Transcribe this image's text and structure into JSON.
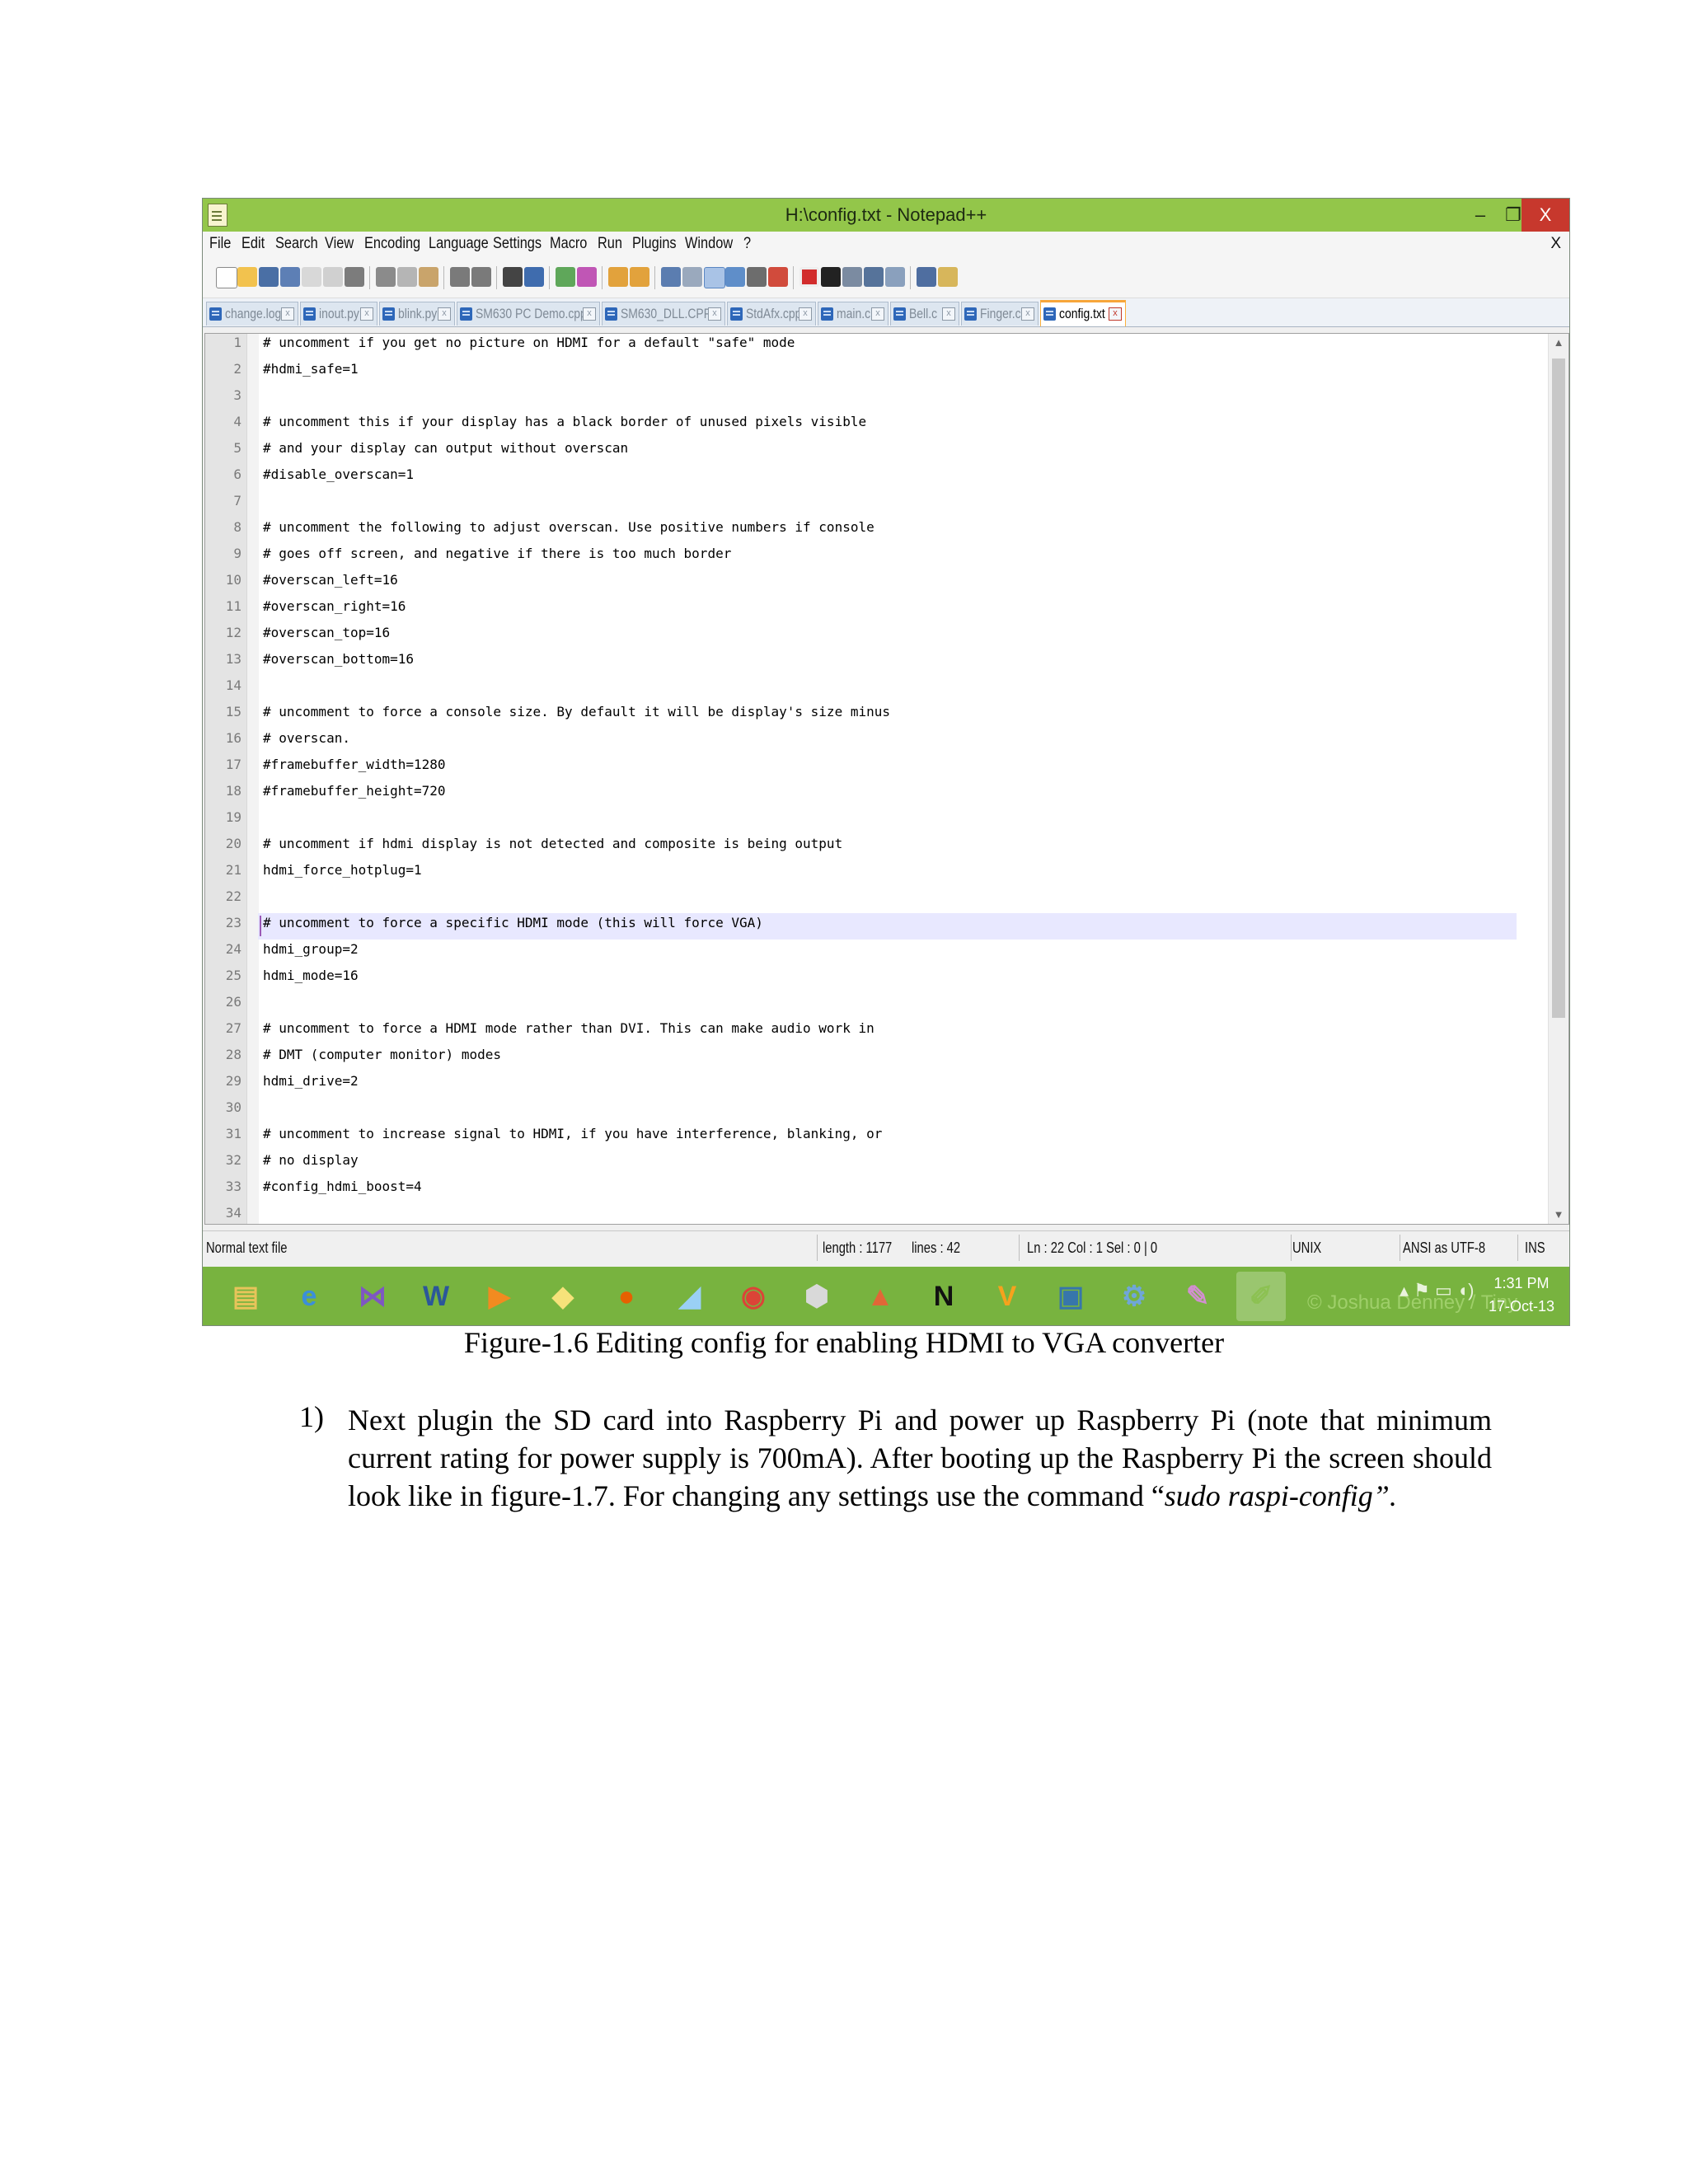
{
  "window": {
    "title": "H:\\config.txt - Notepad++",
    "min": "–",
    "restore": "❐",
    "close": "X"
  },
  "menu": {
    "items": [
      "File",
      "Edit",
      "Search",
      "View",
      "Encoding",
      "Language",
      "Settings",
      "Macro",
      "Run",
      "Plugins",
      "Window",
      "?"
    ],
    "close": "X"
  },
  "tabs": [
    {
      "label": "change.log",
      "active": false
    },
    {
      "label": "inout.py",
      "active": false
    },
    {
      "label": "blink.py",
      "active": false
    },
    {
      "label": "SM630 PC Demo.cpp",
      "active": false
    },
    {
      "label": "SM630_DLL.CPP",
      "active": false
    },
    {
      "label": "StdAfx.cpp",
      "active": false
    },
    {
      "label": "main.c",
      "active": false
    },
    {
      "label": "Bell.c",
      "active": false
    },
    {
      "label": "Finger.c",
      "active": false
    },
    {
      "label": "config.txt",
      "active": true
    }
  ],
  "editor": {
    "lines": [
      "# uncomment if you get no picture on HDMI for a default \"safe\" mode",
      "#hdmi_safe=1",
      "",
      "# uncomment this if your display has a black border of unused pixels visible",
      "# and your display can output without overscan",
      "#disable_overscan=1",
      "",
      "# uncomment the following to adjust overscan. Use positive numbers if console",
      "# goes off screen, and negative if there is too much border",
      "#overscan_left=16",
      "#overscan_right=16",
      "#overscan_top=16",
      "#overscan_bottom=16",
      "",
      "# uncomment to force a console size. By default it will be display's size minus",
      "# overscan.",
      "#framebuffer_width=1280",
      "#framebuffer_height=720",
      "",
      "# uncomment if hdmi display is not detected and composite is being output",
      "hdmi_force_hotplug=1",
      "",
      "# uncomment to force a specific HDMI mode (this will force VGA)",
      "hdmi_group=2",
      "hdmi_mode=16",
      "",
      "# uncomment to force a HDMI mode rather than DVI. This can make audio work in",
      "# DMT (computer monitor) modes",
      "hdmi_drive=2",
      "",
      "# uncomment to increase signal to HDMI, if you have interference, blanking, or",
      "# no display",
      "#config_hdmi_boost=4",
      ""
    ],
    "line_numbers": [
      "1",
      "2",
      "3",
      "4",
      "5",
      "6",
      "7",
      "8",
      "9",
      "10",
      "11",
      "12",
      "13",
      "14",
      "15",
      "16",
      "17",
      "18",
      "19",
      "20",
      "21",
      "22",
      "23",
      "24",
      "25",
      "26",
      "27",
      "28",
      "29",
      "30",
      "31",
      "32",
      "33",
      "34"
    ]
  },
  "status": {
    "file_type": "Normal text file",
    "length": "length : 1177",
    "lines": "lines : 42",
    "position": "Ln : 22    Col : 1    Sel : 0 | 0",
    "eol": "UNIX",
    "encoding": "ANSI as UTF-8",
    "mode": "INS"
  },
  "taskbar": {
    "apps": [
      {
        "name": "file-explorer",
        "glyph": "▤",
        "color": "#e7c45a"
      },
      {
        "name": "internet-explorer",
        "glyph": "e",
        "color": "#3b8fd9"
      },
      {
        "name": "visual-studio",
        "glyph": "⋈",
        "color": "#7e57c2"
      },
      {
        "name": "word",
        "glyph": "W",
        "color": "#2b579a"
      },
      {
        "name": "media-player",
        "glyph": "▶",
        "color": "#f28b20"
      },
      {
        "name": "sticky-notes",
        "glyph": "◆",
        "color": "#f6e27a"
      },
      {
        "name": "firefox",
        "glyph": "●",
        "color": "#e66000"
      },
      {
        "name": "notes-app",
        "glyph": "◢",
        "color": "#9ad0f5"
      },
      {
        "name": "chrome",
        "glyph": "◉",
        "color": "#db4437"
      },
      {
        "name": "virtualbox",
        "glyph": "⬢",
        "color": "#d9d9d9"
      },
      {
        "name": "matlab",
        "glyph": "▲",
        "color": "#e16737"
      },
      {
        "name": "need-for-speed",
        "glyph": "N",
        "color": "#111111"
      },
      {
        "name": "vlc-like",
        "glyph": "V",
        "color": "#f6a21d"
      },
      {
        "name": "python",
        "glyph": "▣",
        "color": "#3776ab"
      },
      {
        "name": "installer",
        "glyph": "⚙",
        "color": "#6fa6d8"
      },
      {
        "name": "paint",
        "glyph": "✎",
        "color": "#d28fd0"
      },
      {
        "name": "notepad-plus-plus",
        "glyph": "✐",
        "color": "#8cc152"
      }
    ],
    "watermark": "© Joshua Denney / Tiny",
    "tray": "▴ ⚑ ▭ ◖)",
    "time": "1:31 PM",
    "date": "17-Oct-13"
  },
  "document": {
    "caption": "Figure-1.6 Editing config for enabling HDMI to VGA converter",
    "item_number": "1)",
    "paragraph_main": "Next plugin the SD card into Raspberry Pi and power up Raspberry Pi (note that minimum current rating for power supply is 700mA). After booting up the Raspberry Pi the screen should look like in figure-1.7. For changing any settings use the command “",
    "paragraph_command": "sudo raspi-config”."
  }
}
